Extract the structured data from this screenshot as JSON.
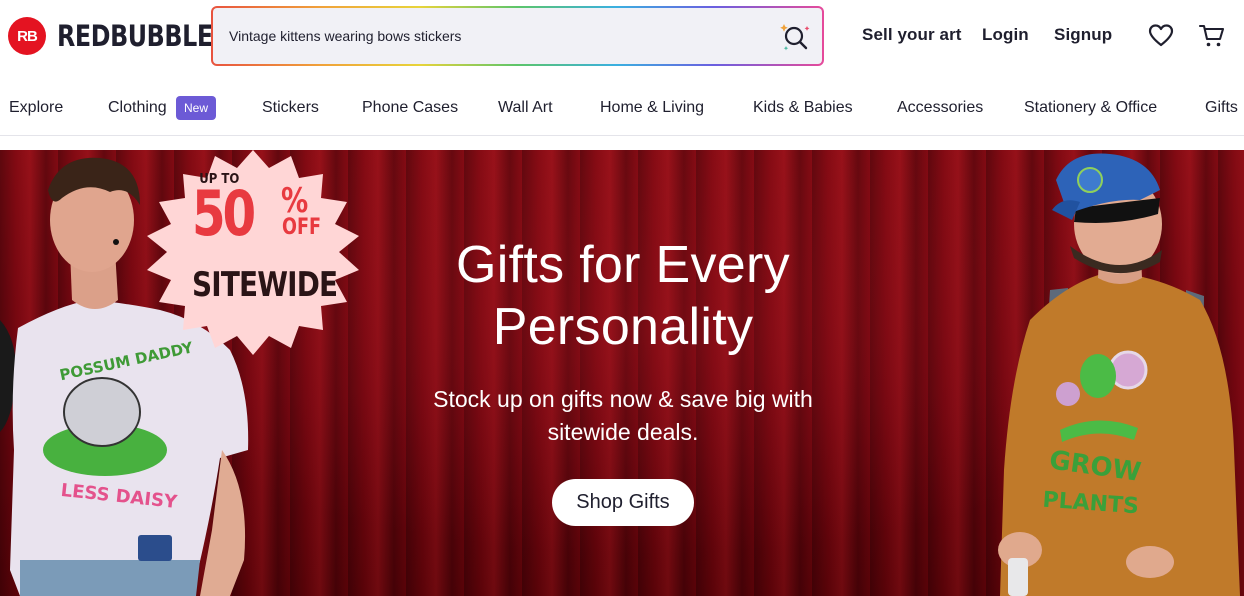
{
  "brand": {
    "logo_mark": "RB",
    "name": "REDBUBBLE",
    "accent": "#e41321"
  },
  "search": {
    "placeholder": "Vintage kittens wearing bows stickers",
    "value": ""
  },
  "header_links": {
    "sell": "Sell your art",
    "login": "Login",
    "signup": "Signup"
  },
  "icons": {
    "search": "search-icon",
    "wishlist": "heart-icon",
    "cart": "cart-icon"
  },
  "nav": {
    "items": [
      {
        "label": "Explore"
      },
      {
        "label": "Clothing",
        "badge": "New"
      },
      {
        "label": "Stickers"
      },
      {
        "label": "Phone Cases"
      },
      {
        "label": "Wall Art"
      },
      {
        "label": "Home & Living"
      },
      {
        "label": "Kids & Babies"
      },
      {
        "label": "Accessories"
      },
      {
        "label": "Stationery & Office"
      },
      {
        "label": "Gifts"
      }
    ]
  },
  "hero": {
    "promo": {
      "up_to": "UP TO",
      "number": "50",
      "percent": "%",
      "off": "OFF",
      "sitewide": "SITEWIDE"
    },
    "title": "Gifts for Every Personality",
    "subtitle": "Stock up on gifts now & save big with sitewide deals.",
    "cta": "Shop Gifts",
    "colors": {
      "curtain": "#7a0610",
      "badge_bg": "#ffd6d6",
      "promo_red": "#e83a40"
    },
    "shirt_left_text": [
      "POSSUM DADDY",
      "LESS DAISY"
    ],
    "shirt_right_text": [
      "GROW",
      "PLANTS"
    ]
  }
}
